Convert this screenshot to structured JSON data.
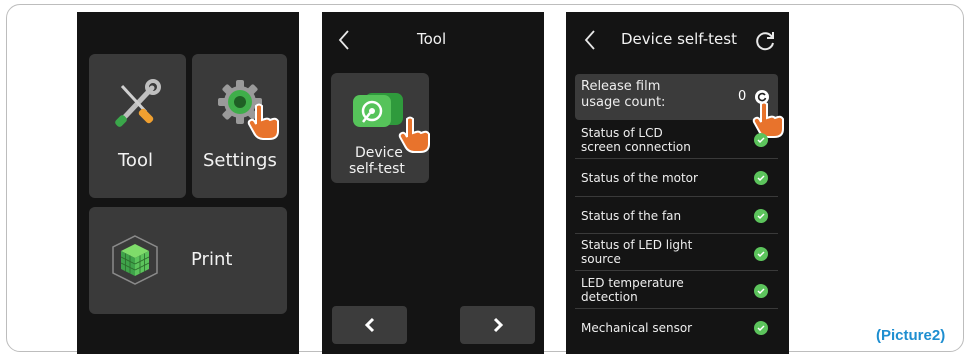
{
  "screen1": {
    "tiles": [
      {
        "label": "Tool",
        "icon": "wrench-screwdriver-icon"
      },
      {
        "label": "Settings",
        "icon": "gear-icon"
      },
      {
        "label": "Print",
        "icon": "cube-icon"
      }
    ]
  },
  "screen2": {
    "title": "Tool",
    "app_tile": {
      "label_line1": "Device",
      "label_line2": "self-test",
      "icon": "self-test-icon"
    },
    "nav": {
      "prev_icon": "chevron-left-icon",
      "next_icon": "chevron-right-icon"
    }
  },
  "screen3": {
    "title": "Device self-test",
    "release_film": {
      "label_line1": "Release film",
      "label_line2": "usage count:",
      "value": "0"
    },
    "checks": [
      {
        "line1": "Status of LCD",
        "line2": "screen connection",
        "ok": true
      },
      {
        "line1": "Status of the motor",
        "line2": "",
        "ok": true
      },
      {
        "line1": "Status of the fan",
        "line2": "",
        "ok": true
      },
      {
        "line1": "Status of LED light",
        "line2": "source",
        "ok": true
      },
      {
        "line1": "LED temperature",
        "line2": "detection",
        "ok": true
      },
      {
        "line1": "Mechanical sensor",
        "line2": "",
        "ok": true
      }
    ]
  },
  "caption": "(Picture2)",
  "colors": {
    "screen_bg": "#141414",
    "tile_bg": "#3a3a3a",
    "check_green": "#5cc45c",
    "caption_blue": "#1e8ed0",
    "hand_orange": "#e8732c"
  }
}
